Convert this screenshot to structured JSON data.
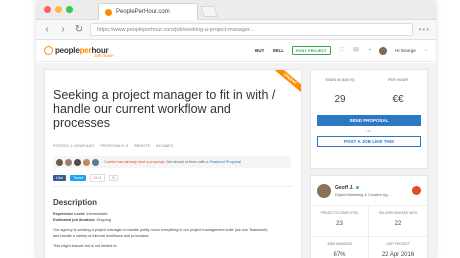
{
  "browser": {
    "tab_title": "PeoplePerHour.com",
    "url": "https://www.peopleperhour.com/job/seeking-a-project-manager..."
  },
  "site": {
    "logo_prefix": "people",
    "logo_highlight": "per",
    "logo_suffix": "hour",
    "tagline": "Job done!",
    "nav": {
      "buy": "BUY",
      "sell": "SELL",
      "post_project": "POST PROJECT",
      "user_name": "Hi George"
    }
  },
  "job": {
    "ribbon": "URGENT",
    "title": "Seeking a project manager to fit in with / handle our current workflow and processes",
    "meta": {
      "posted": "POSTED: 1 HOUR AGO",
      "proposals": "PROPOSALS: 8",
      "remote": "REMOTE",
      "id": "#1236874"
    },
    "proposals_note_red": "1 seller has already sent a proposal.",
    "proposals_note_rest": "Get ahead of them with a",
    "proposals_note_link": "Featured Proposal",
    "share": {
      "facebook": "Like",
      "twitter": "Tweet",
      "gplus": "G+1",
      "count": "0"
    },
    "description_heading": "Description",
    "experience_label": "Experience Level:",
    "experience_value": "Intermediate",
    "duration_label": "Estimated job duration:",
    "duration_value": "Ongoing",
    "body_1": "Our agency is seeking a project manager to handle pretty much everything in our project management suite (we use Teamwork)",
    "body_2": "and handle a variety of internal workflows and processes.",
    "body_3": "This might include but is not limited to:"
  },
  "pricing": {
    "ends_label": "ENDS IN (DAYS)",
    "ends_value": "29",
    "rate_label": "PER HOUR",
    "rate_value": "€€",
    "send_proposal": "SEND PROPOSAL",
    "or": "- or -",
    "post_like": "POST A JOB LIKE THIS"
  },
  "buyer": {
    "name": "Geoff J.",
    "role": "Digital Marketing & Creative Ag...",
    "stats": [
      {
        "label": "PROJECTS COMPLETED",
        "value": "23"
      },
      {
        "label": "SELLERS WORKED WITH",
        "value": "22"
      },
      {
        "label": "JOBS AWARDED",
        "value": "67%"
      },
      {
        "label": "LAST PROJECT",
        "value": "22 Apr 2016"
      }
    ]
  },
  "colors": {
    "brand_orange": "#ff8a00",
    "primary_blue": "#2b78c5",
    "accent_green": "#34a853"
  }
}
